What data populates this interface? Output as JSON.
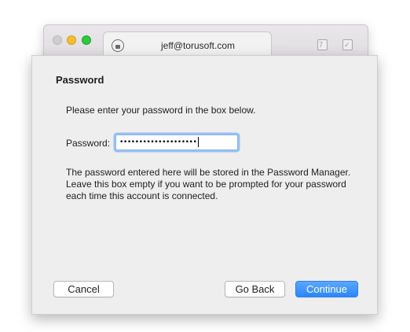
{
  "background_window": {
    "tab_title": "jeff@torusoft.com",
    "tab_icon": "lock-globe-icon",
    "toolbar_icons": [
      "calendar-icon",
      "tasks-icon"
    ]
  },
  "dialog": {
    "heading": "Password",
    "instruction": "Please enter your password in the box below.",
    "password_label": "Password:",
    "password_value": "••••••••••••••••••••",
    "info_lines": [
      "The password entered here will be stored in the Password Manager.",
      "Leave this box empty if you want to be prompted for your password",
      "each time this account is connected."
    ],
    "buttons": {
      "cancel": "Cancel",
      "go_back": "Go Back",
      "continue": "Continue"
    }
  },
  "colors": {
    "accent": "#2b86fa",
    "focus_ring": "#98c0f2",
    "sheet_bg": "#eeeeee"
  }
}
